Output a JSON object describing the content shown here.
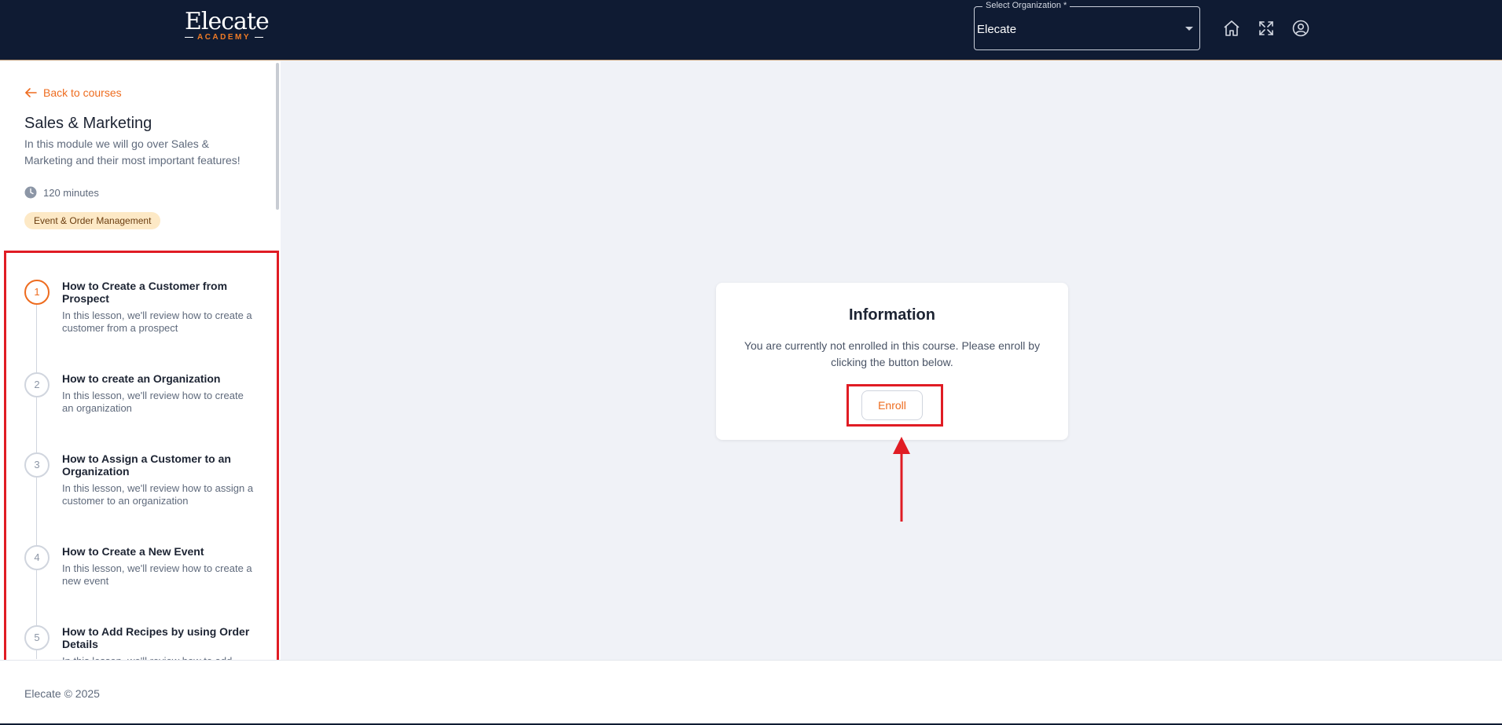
{
  "header": {
    "logo_main": "Elecate",
    "logo_sub": "ACADEMY",
    "org_select": {
      "label": "Select Organization *",
      "value": "Elecate"
    },
    "icons": [
      "home-icon",
      "fullscreen-icon",
      "account-icon"
    ]
  },
  "sidebar": {
    "back_label": "Back to courses",
    "course_title": "Sales & Marketing",
    "course_description": "In this module we will go over Sales & Marketing and their most important features!",
    "duration": "120 minutes",
    "tag": "Event & Order Management",
    "lessons": [
      {
        "number": "1",
        "title": "How to Create a Customer from Prospect",
        "description": "In this lesson, we'll review how to create a customer from a prospect"
      },
      {
        "number": "2",
        "title": "How to create an Organization",
        "description": "In this lesson, we'll review how to create an organization"
      },
      {
        "number": "3",
        "title": "How to Assign a Customer to an Organization",
        "description": "In this lesson, we'll review how to assign a customer to an organization"
      },
      {
        "number": "4",
        "title": "How to Create a New Event",
        "description": "In this lesson, we'll review how to create a new event"
      },
      {
        "number": "5",
        "title": "How to Add Recipes by using Order Details",
        "description": "In this lesson, we'll review how to add"
      }
    ]
  },
  "main": {
    "card_title": "Information",
    "card_text": "You are currently not enrolled in this course. Please enroll by clicking the button below.",
    "enroll_label": "Enroll"
  },
  "footer": {
    "text": "Elecate © 2025"
  },
  "colors": {
    "header_bg": "#0f1b33",
    "accent": "#ee6c1f",
    "highlight": "#e01c24",
    "page_bg": "#f0f2f7"
  }
}
